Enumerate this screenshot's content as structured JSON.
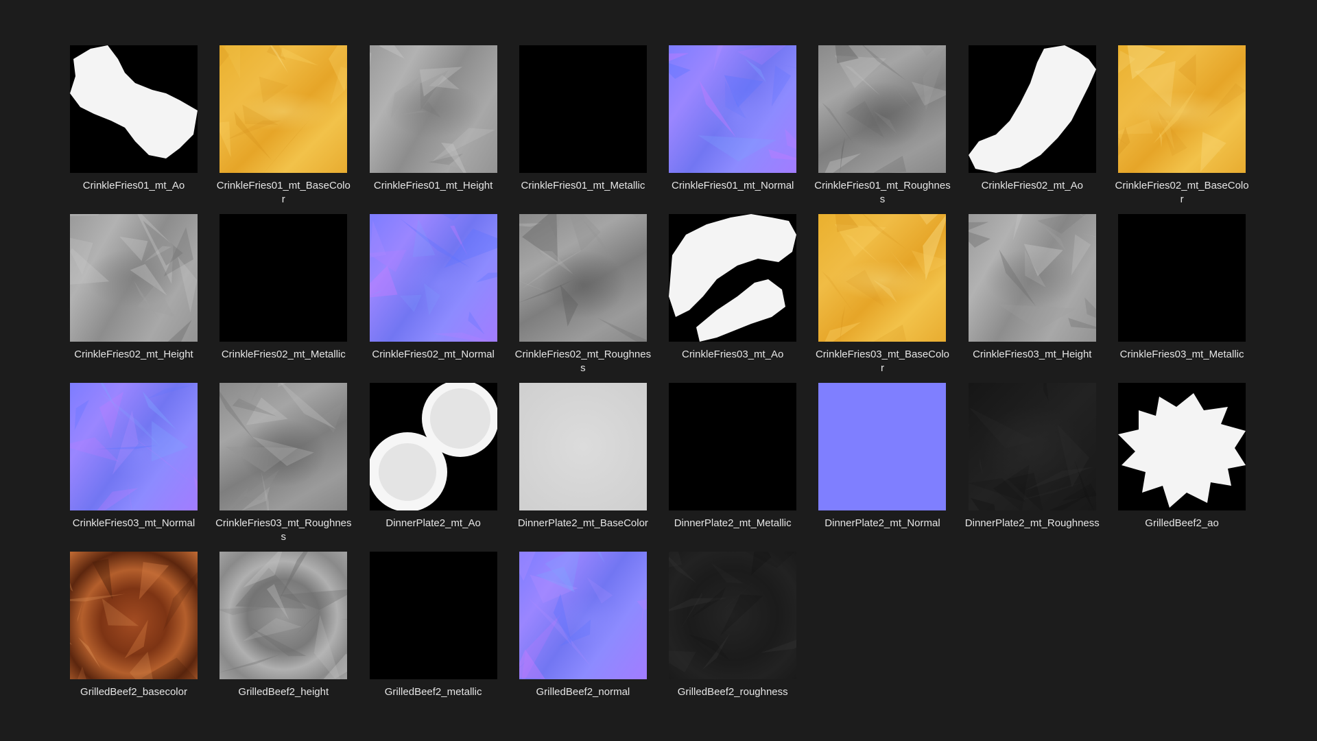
{
  "window": {
    "background": "#1c1c1c"
  },
  "items": [
    {
      "name": "CrinkleFries01_mt_Ao",
      "texture": "ao-fries-1"
    },
    {
      "name": "CrinkleFries01_mt_BaseColor",
      "texture": "basecolor"
    },
    {
      "name": "CrinkleFries01_mt_Height",
      "texture": "height"
    },
    {
      "name": "CrinkleFries01_mt_Metallic",
      "texture": "black"
    },
    {
      "name": "CrinkleFries01_mt_Normal",
      "texture": "normal"
    },
    {
      "name": "CrinkleFries01_mt_Roughness",
      "texture": "roughness"
    },
    {
      "name": "CrinkleFries02_mt_Ao",
      "texture": "ao-fries-2"
    },
    {
      "name": "CrinkleFries02_mt_BaseColor",
      "texture": "basecolor"
    },
    {
      "name": "CrinkleFries02_mt_Height",
      "texture": "height"
    },
    {
      "name": "CrinkleFries02_mt_Metallic",
      "texture": "black"
    },
    {
      "name": "CrinkleFries02_mt_Normal",
      "texture": "normal"
    },
    {
      "name": "CrinkleFries02_mt_Roughness",
      "texture": "roughness"
    },
    {
      "name": "CrinkleFries03_mt_Ao",
      "texture": "ao-fries-3"
    },
    {
      "name": "CrinkleFries03_mt_BaseColor",
      "texture": "basecolor"
    },
    {
      "name": "CrinkleFries03_mt_Height",
      "texture": "height"
    },
    {
      "name": "CrinkleFries03_mt_Metallic",
      "texture": "black"
    },
    {
      "name": "CrinkleFries03_mt_Normal",
      "texture": "normal"
    },
    {
      "name": "CrinkleFries03_mt_Roughness",
      "texture": "roughness"
    },
    {
      "name": "DinnerPlate2_mt_Ao",
      "texture": "ao-plate"
    },
    {
      "name": "DinnerPlate2_mt_BaseColor",
      "texture": "plate-basecolor"
    },
    {
      "name": "DinnerPlate2_mt_Metallic",
      "texture": "black"
    },
    {
      "name": "DinnerPlate2_mt_Normal",
      "texture": "normal-flat"
    },
    {
      "name": "DinnerPlate2_mt_Roughness",
      "texture": "roughness-dark"
    },
    {
      "name": "GrilledBeef2_ao",
      "texture": "ao-beef"
    },
    {
      "name": "GrilledBeef2_basecolor",
      "texture": "beef-basecolor"
    },
    {
      "name": "GrilledBeef2_height",
      "texture": "beef-height"
    },
    {
      "name": "GrilledBeef2_metallic",
      "texture": "black"
    },
    {
      "name": "GrilledBeef2_normal",
      "texture": "normal"
    },
    {
      "name": "GrilledBeef2_roughness",
      "texture": "beef-roughness"
    }
  ]
}
